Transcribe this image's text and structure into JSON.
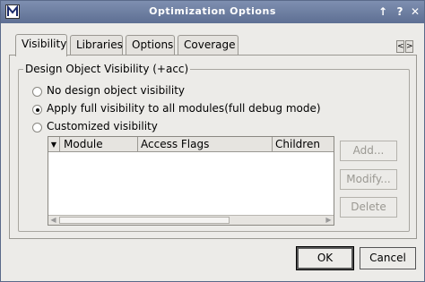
{
  "window": {
    "title": "Optimization Options"
  },
  "tabs": [
    {
      "label": "Visibility",
      "active": true
    },
    {
      "label": "Libraries",
      "active": false
    },
    {
      "label": "Options",
      "active": false
    },
    {
      "label": "Coverage",
      "active": false
    }
  ],
  "tab_scroll": {
    "left": "<",
    "right": ">"
  },
  "group": {
    "legend": "Design Object Visibility (+acc)",
    "radios": [
      {
        "label": "No design object visibility",
        "checked": false
      },
      {
        "label": "Apply full visibility to all modules(full debug mode)",
        "checked": true
      },
      {
        "label": "Customized visibility",
        "checked": false
      }
    ]
  },
  "table": {
    "columns": [
      "Module",
      "Access Flags",
      "Children"
    ],
    "rows": []
  },
  "side_buttons": {
    "add": "Add...",
    "modify": "Modify...",
    "delete": "Delete"
  },
  "dialog_buttons": {
    "ok": "OK",
    "cancel": "Cancel"
  }
}
